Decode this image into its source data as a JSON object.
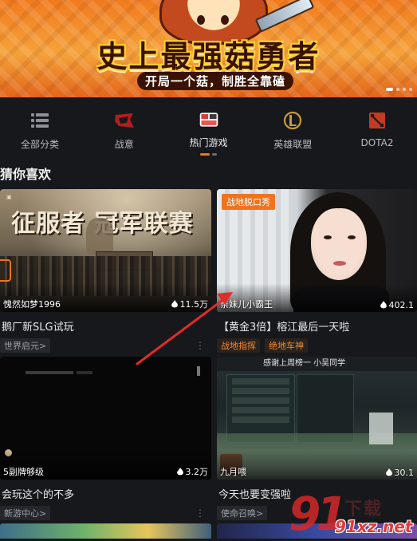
{
  "banner": {
    "title": "史上最强菇勇者",
    "subtitle": "开局一个菇，制胜全靠磕"
  },
  "categories": [
    {
      "label": "全部分类",
      "icon": "grid-list-icon"
    },
    {
      "label": "战意",
      "icon": "zhanyi-game-icon"
    },
    {
      "label": "热门游戏",
      "icon": "hot-games-icon",
      "active": true
    },
    {
      "label": "英雄联盟",
      "icon": "league-of-legends-icon"
    },
    {
      "label": "DOTA2",
      "icon": "dota2-icon"
    }
  ],
  "section_title": "猜你喜欢",
  "cards": [
    {
      "thumb_title": "征服者 冠军联赛",
      "streamer": "愧然如梦1996",
      "viewers": "11.5万",
      "title": "鹅厂新SLG试玩",
      "tags": [
        "世界启元>"
      ]
    },
    {
      "badge": "战地脱口秀",
      "streamer": "亲妹儿小霸王",
      "viewers": "402.1",
      "title": "【黄金3倍】榕江最后一天啦",
      "tags": [
        "战地指挥",
        "绝地车神"
      ]
    },
    {
      "streamer": "5副牌够级",
      "viewers": "3.2万",
      "title": "会玩这个的不多",
      "tags": [
        "新游中心>"
      ]
    },
    {
      "thumb_banner": "感谢上周榜一 小吴同学",
      "streamer": "九月喂",
      "viewers": "30.1",
      "title": "今天也要变强啦",
      "tags": [
        "使命召唤>"
      ]
    }
  ],
  "watermark": {
    "logo": "91",
    "text": "91xz.net"
  },
  "colors": {
    "background": "#17181c",
    "accent": "#f0731e",
    "tag_orange": "#f58a2c",
    "annotation_arrow": "#e02b2b"
  }
}
